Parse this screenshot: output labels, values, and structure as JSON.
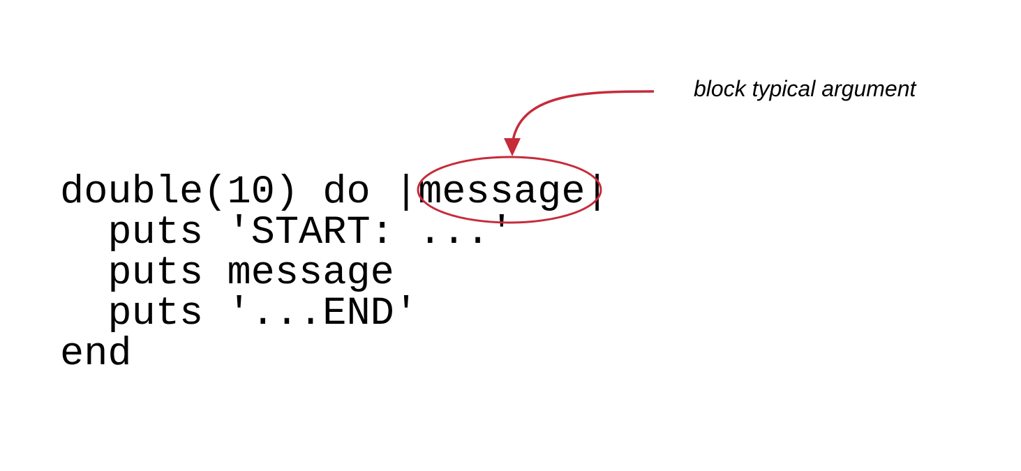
{
  "annotation": {
    "label": "block typical argument",
    "color": "#c62b3a"
  },
  "code": {
    "lines": [
      "double(10) do |message|",
      "  puts 'START: ...'",
      "  puts message",
      "  puts '...END'",
      "end"
    ],
    "highlighted_token": "message"
  }
}
